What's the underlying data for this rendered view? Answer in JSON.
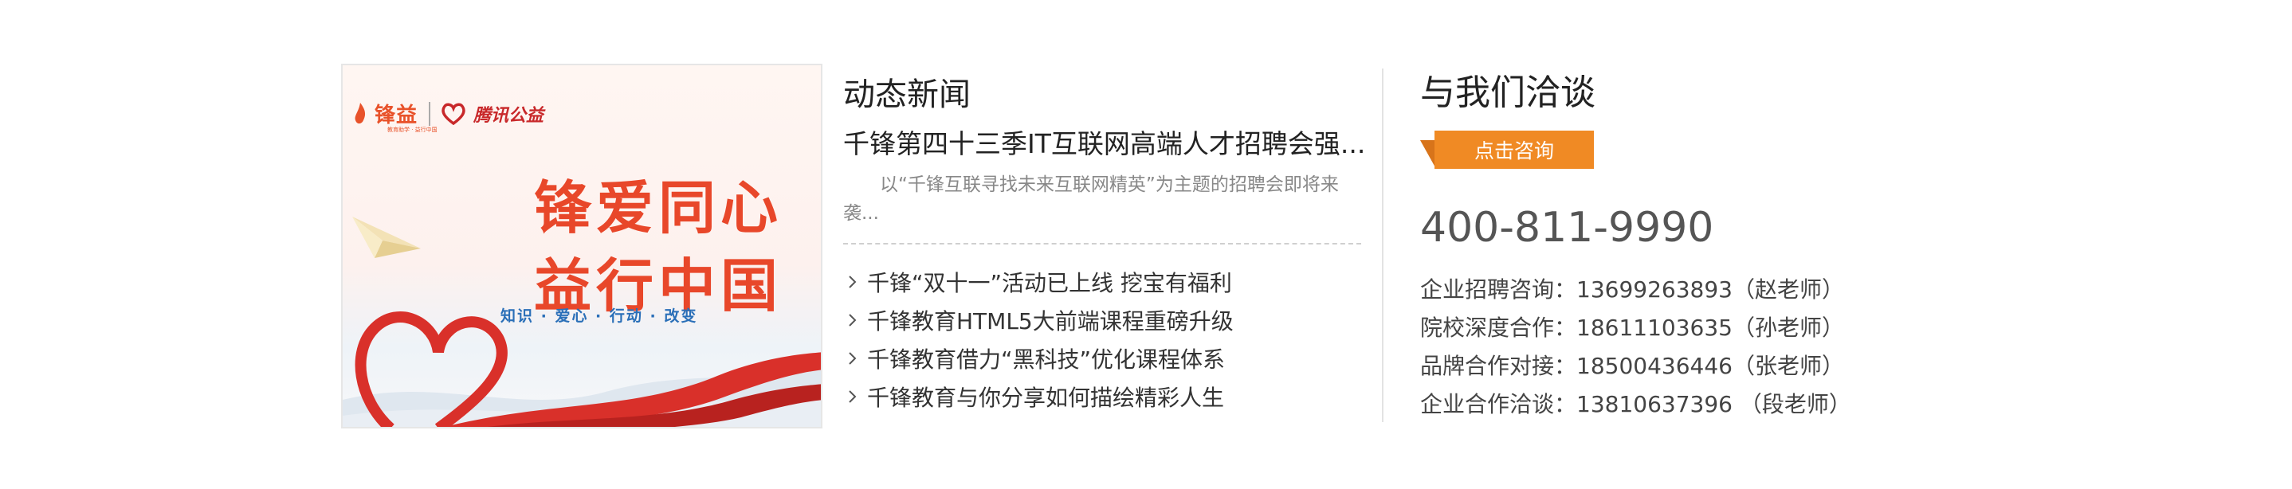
{
  "banner": {
    "brand_name": "锋益",
    "brand_sub": "教育助学 · 益行中国",
    "partner_name": "腾讯公益",
    "slogan_line1": "锋爱同心",
    "slogan_line2": "益行中国",
    "slogan_sub": "知识 · 爱心 · 行动 · 改变",
    "colors": {
      "brand": "#e8522a",
      "slogan": "#e8472a",
      "keywords": "#2a6fb8",
      "ribbon": "#d9302a"
    }
  },
  "news": {
    "title": "动态新闻",
    "headline": "千锋第四十三季IT互联网高端人才招聘会强...",
    "summary": "以“千锋互联寻找未来互联网精英”为主题的招聘会即将来袭...",
    "items": [
      {
        "label": "千锋“双十一”活动已上线 挖宝有福利",
        "icon": "chevron-right-icon"
      },
      {
        "label": "千锋教育HTML5大前端课程重磅升级",
        "icon": "chevron-right-icon"
      },
      {
        "label": "千锋教育借力“黑科技”优化课程体系",
        "icon": "chevron-right-icon"
      },
      {
        "label": "千锋教育与你分享如何描绘精彩人生",
        "icon": "chevron-right-icon"
      }
    ]
  },
  "contact": {
    "title": "与我们洽谈",
    "button_label": "点击咨询",
    "phone": "400-811-9990",
    "items": [
      "企业招聘咨询：13699263893（赵老师）",
      "院校深度合作：18611103635（孙老师）",
      "品牌合作对接：18500436446（张老师）",
      "企业合作洽谈：13810637396 （段老师）"
    ],
    "colors": {
      "button": "#f08a24"
    }
  }
}
